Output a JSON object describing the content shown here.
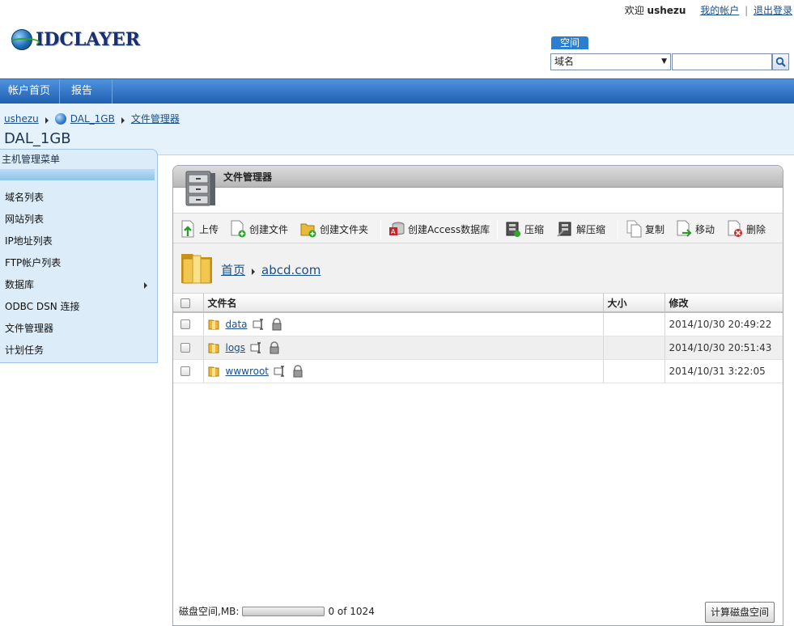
{
  "header": {
    "welcome": "欢迎",
    "username": "ushezu",
    "my_account": "我的帐户",
    "separator": "|",
    "logout": "退出登录",
    "logo_text": "IDCLAYER"
  },
  "search": {
    "tab_label": "空间",
    "select_value": "域名",
    "input_value": ""
  },
  "nav": {
    "items": [
      {
        "label": "帐户首页"
      },
      {
        "label": "报告"
      }
    ]
  },
  "breadcrumb": {
    "items": [
      "ushezu",
      "DAL_1GB",
      "文件管理器"
    ],
    "page_title": "DAL_1GB"
  },
  "sidebar": {
    "title": "主机管理菜单",
    "items": [
      {
        "label": "域名列表"
      },
      {
        "label": "网站列表"
      },
      {
        "label": "IP地址列表"
      },
      {
        "label": "FTP帐户列表"
      },
      {
        "label": "数据库",
        "has_submenu": true
      },
      {
        "label": "ODBC DSN 连接"
      },
      {
        "label": "文件管理器"
      },
      {
        "label": "计划任务"
      }
    ]
  },
  "panel": {
    "title": "文件管理器",
    "toolbar": {
      "upload": "上传",
      "create_file": "创建文件",
      "create_folder": "创建文件夹",
      "create_access_db": "创建Access数据库",
      "compress": "压缩",
      "decompress": "解压缩",
      "copy": "复制",
      "move": "移动",
      "delete": "删除"
    },
    "path": {
      "home": "首页",
      "current": "abcd.com"
    },
    "columns": {
      "name": "文件名",
      "size": "大小",
      "modified": "修改"
    },
    "files": [
      {
        "name": "data",
        "size": "",
        "modified": "2014/10/30 20:49:22"
      },
      {
        "name": "logs",
        "size": "",
        "modified": "2014/10/30 20:51:43"
      },
      {
        "name": "wwwroot",
        "size": "",
        "modified": "2014/10/31 3:22:05"
      }
    ],
    "disk": {
      "label": "磁盘空间,MB:",
      "usage_text": "0 of 1024",
      "used_fraction": 0
    },
    "calc_button": "计算磁盘空间"
  },
  "colors": {
    "nav_blue": "#1f5fb0",
    "link": "#1a4f8a",
    "sidebar_bg": "#dcecf9",
    "crumb_bg": "#e6f2fb"
  }
}
